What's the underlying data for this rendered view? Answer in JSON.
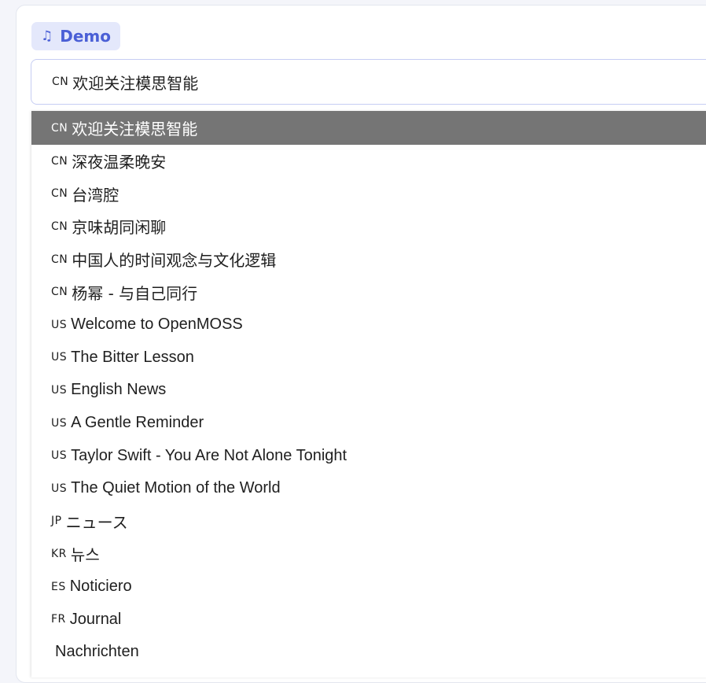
{
  "badge": {
    "icon": "music-note-icon",
    "glyph": "♫",
    "label": "Demo"
  },
  "select": {
    "flag": "CN",
    "value": "欢迎关注模思智能"
  },
  "options": [
    {
      "flag": "CN",
      "label": "欢迎关注模思智能",
      "selected": true
    },
    {
      "flag": "CN",
      "label": "深夜温柔晚安"
    },
    {
      "flag": "CN",
      "label": "台湾腔"
    },
    {
      "flag": "CN",
      "label": "京味胡同闲聊"
    },
    {
      "flag": "CN",
      "label": "中国人的时间观念与文化逻辑"
    },
    {
      "flag": "CN",
      "label": "杨幂 - 与自己同行"
    },
    {
      "flag": "US",
      "label": "Welcome to OpenMOSS"
    },
    {
      "flag": "US",
      "label": "The Bitter Lesson"
    },
    {
      "flag": "US",
      "label": "English News"
    },
    {
      "flag": "US",
      "label": "A Gentle Reminder"
    },
    {
      "flag": "US",
      "label": "Taylor Swift - You Are Not Alone Tonight"
    },
    {
      "flag": "US",
      "label": "The Quiet Motion of the World"
    },
    {
      "flag": "JP",
      "label": "ニュース"
    },
    {
      "flag": "KR",
      "label": "뉴스"
    },
    {
      "flag": "ES",
      "label": "Noticiero"
    },
    {
      "flag": "FR",
      "label": "Journal"
    },
    {
      "flag": "",
      "label": "Nachrichten"
    }
  ],
  "colors": {
    "accent": "#4a5fd6",
    "badge_bg": "#e4e8fb",
    "selected_bg": "#757575"
  }
}
